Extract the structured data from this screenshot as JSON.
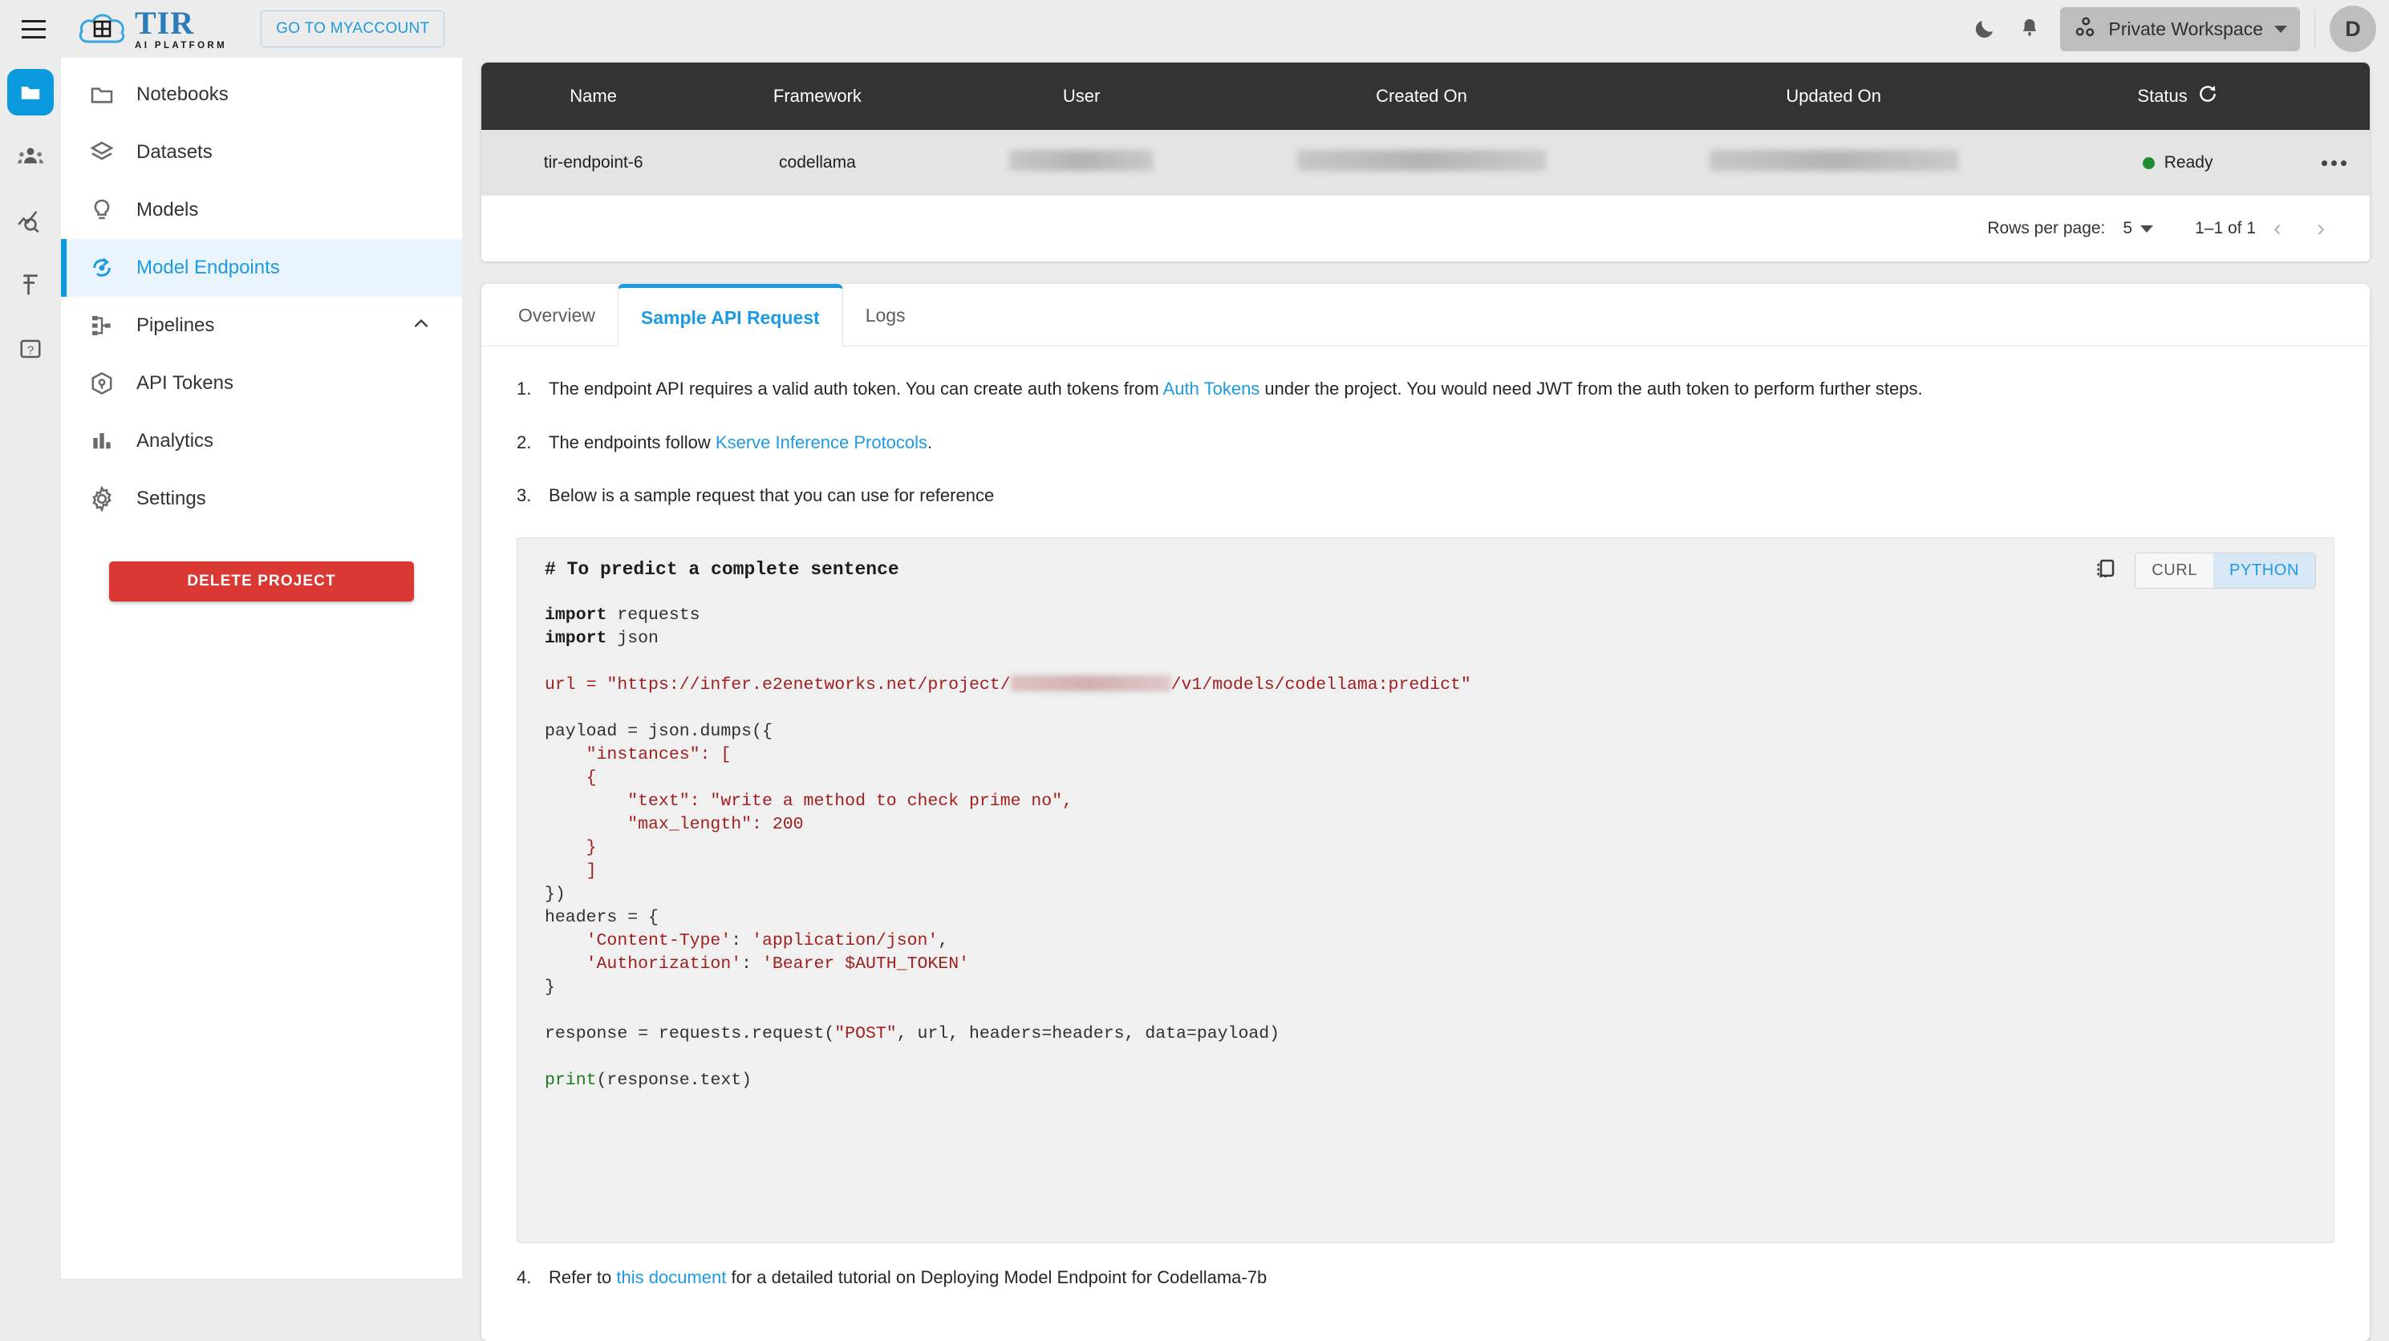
{
  "header": {
    "brand_name": "TIR",
    "brand_sub": "AI PLATFORM",
    "brand_cloud_label": "E2E Cloud",
    "myaccount_button": "GO TO MYACCOUNT",
    "workspace_label": "Private Workspace",
    "avatar_initial": "D",
    "accent_color": "#1e9ae0"
  },
  "rail": {
    "items": [
      {
        "name": "projects",
        "icon": "folder-icon",
        "active": true
      },
      {
        "name": "team",
        "icon": "people-icon",
        "active": false
      },
      {
        "name": "monitoring",
        "icon": "chart-search-icon",
        "active": false
      },
      {
        "name": "billing",
        "icon": "rupee-icon",
        "active": false
      },
      {
        "name": "help",
        "icon": "help-icon",
        "active": false
      }
    ]
  },
  "sidebar": {
    "items": [
      {
        "label": "Notebooks",
        "icon": "folder-icon",
        "active": false,
        "expandable": false
      },
      {
        "label": "Datasets",
        "icon": "layers-icon",
        "active": false,
        "expandable": false
      },
      {
        "label": "Models",
        "icon": "bulb-icon",
        "active": false,
        "expandable": false
      },
      {
        "label": "Model Endpoints",
        "icon": "endpoint-icon",
        "active": true,
        "expandable": false
      },
      {
        "label": "Pipelines",
        "icon": "pipeline-icon",
        "active": false,
        "expandable": true
      },
      {
        "label": "API Tokens",
        "icon": "cube-icon",
        "active": false,
        "expandable": false
      },
      {
        "label": "Analytics",
        "icon": "bar-chart-icon",
        "active": false,
        "expandable": false
      },
      {
        "label": "Settings",
        "icon": "gear-icon",
        "active": false,
        "expandable": false
      }
    ],
    "delete_button": "DELETE PROJECT",
    "delete_color": "#d93833"
  },
  "table": {
    "columns": [
      "Name",
      "Framework",
      "User",
      "Created On",
      "Updated On",
      "Status"
    ],
    "status_refresh_icon": "refresh-icon",
    "rows": [
      {
        "name": "tir-endpoint-6",
        "framework": "codellama",
        "user": "",
        "created_on": "",
        "updated_on": "",
        "status": "Ready",
        "status_color": "#1f8b32",
        "redacted": [
          "user",
          "created_on",
          "updated_on"
        ]
      }
    ],
    "pagination": {
      "rows_per_page_label": "Rows per page:",
      "rows_per_page_value": "5",
      "range": "1–1 of 1",
      "prev": "‹",
      "next": "›"
    }
  },
  "detail": {
    "tabs": [
      {
        "label": "Overview",
        "active": false
      },
      {
        "label": "Sample API Request",
        "active": true
      },
      {
        "label": "Logs",
        "active": false
      }
    ],
    "notes": [
      {
        "num": "1.",
        "parts": [
          {
            "t": "The endpoint API requires a valid auth token. You can create auth tokens from ",
            "link": false
          },
          {
            "t": "Auth Tokens",
            "link": true
          },
          {
            "t": " under the project. You would need JWT from the auth token to perform further steps.",
            "link": false
          }
        ]
      },
      {
        "num": "2.",
        "parts": [
          {
            "t": "The endpoints follow ",
            "link": false
          },
          {
            "t": "Kserve Inference Protocols",
            "link": true
          },
          {
            "t": ".",
            "link": false
          }
        ]
      },
      {
        "num": "3.",
        "parts": [
          {
            "t": "Below is a sample request that you can use for reference",
            "link": false
          }
        ]
      }
    ],
    "footer_note": {
      "num": "4.",
      "parts": [
        {
          "t": "Refer to ",
          "link": false
        },
        {
          "t": "this document",
          "link": true
        },
        {
          "t": " for a detailed tutorial on Deploying Model Endpoint for Codellama-7b",
          "link": false
        }
      ]
    },
    "code_block": {
      "title": "# To predict a complete sentence",
      "copy_icon": "copy-icon",
      "lang_tabs": [
        {
          "label": "CURL",
          "active": false
        },
        {
          "label": "PYTHON",
          "active": true
        }
      ],
      "url_prefix": "\"https://infer.e2enetworks.net/project/",
      "url_suffix": "/v1/models/codellama:predict\"",
      "url_redacted": true,
      "lines": [
        {
          "tokens": [
            {
              "t": "import",
              "c": "kw"
            },
            {
              "t": " requests",
              "c": ""
            }
          ]
        },
        {
          "tokens": [
            {
              "t": "import",
              "c": "kw"
            },
            {
              "t": " json",
              "c": ""
            }
          ]
        },
        {
          "tokens": []
        },
        {
          "tokens": [
            {
              "t": "__URL__",
              "c": "url"
            }
          ]
        },
        {
          "tokens": []
        },
        {
          "tokens": [
            {
              "t": "payload = json.dumps({",
              "c": ""
            }
          ]
        },
        {
          "tokens": [
            {
              "t": "    ",
              "c": ""
            },
            {
              "t": "\"instances\"",
              "c": "str"
            },
            {
              "t": ": [",
              "c": "str"
            }
          ]
        },
        {
          "tokens": [
            {
              "t": "    ",
              "c": ""
            },
            {
              "t": "{",
              "c": "str"
            }
          ]
        },
        {
          "tokens": [
            {
              "t": "        ",
              "c": ""
            },
            {
              "t": "\"text\": \"write a method to check prime no\",",
              "c": "str"
            }
          ]
        },
        {
          "tokens": [
            {
              "t": "        ",
              "c": ""
            },
            {
              "t": "\"max_length\": 200",
              "c": "str"
            }
          ]
        },
        {
          "tokens": [
            {
              "t": "    ",
              "c": ""
            },
            {
              "t": "}",
              "c": "str"
            }
          ]
        },
        {
          "tokens": [
            {
              "t": "    ",
              "c": ""
            },
            {
              "t": "]",
              "c": "str"
            }
          ]
        },
        {
          "tokens": [
            {
              "t": "})",
              "c": ""
            }
          ]
        },
        {
          "tokens": [
            {
              "t": "headers = {",
              "c": ""
            }
          ]
        },
        {
          "tokens": [
            {
              "t": "    ",
              "c": ""
            },
            {
              "t": "'Content-Type'",
              "c": "str"
            },
            {
              "t": ": ",
              "c": ""
            },
            {
              "t": "'application/json'",
              "c": "str"
            },
            {
              "t": ",",
              "c": ""
            }
          ]
        },
        {
          "tokens": [
            {
              "t": "    ",
              "c": ""
            },
            {
              "t": "'Authorization'",
              "c": "str"
            },
            {
              "t": ": ",
              "c": ""
            },
            {
              "t": "'Bearer $AUTH_TOKEN'",
              "c": "str"
            }
          ]
        },
        {
          "tokens": [
            {
              "t": "}",
              "c": ""
            }
          ]
        },
        {
          "tokens": []
        },
        {
          "tokens": [
            {
              "t": "response = requests.request(",
              "c": ""
            },
            {
              "t": "\"POST\"",
              "c": "str"
            },
            {
              "t": ", url, headers=headers, data=payload)",
              "c": ""
            }
          ]
        },
        {
          "tokens": []
        },
        {
          "tokens": [
            {
              "t": "print",
              "c": "fn"
            },
            {
              "t": "(response.text)",
              "c": ""
            }
          ]
        }
      ]
    }
  }
}
